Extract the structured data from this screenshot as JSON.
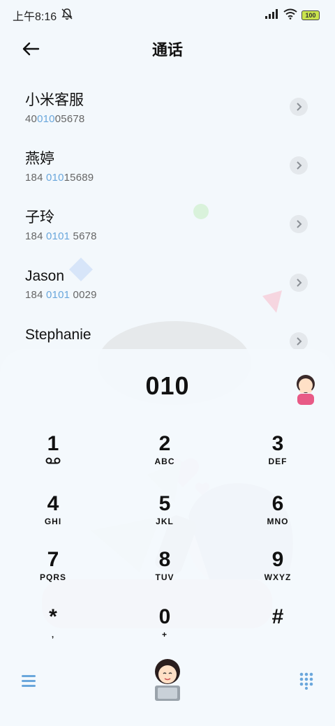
{
  "status_bar": {
    "time": "上午8:16",
    "battery": "100"
  },
  "header": {
    "title": "通话"
  },
  "contacts": [
    {
      "name": "小米客服",
      "number_pre": "40",
      "number_hl": "010",
      "number_post": "05678"
    },
    {
      "name": "燕婷",
      "number_pre": "184 ",
      "number_hl": "010",
      "number_post": "15689"
    },
    {
      "name": "子玲",
      "number_pre": "184 ",
      "number_hl": "0101",
      "number_post": " 5678"
    },
    {
      "name": "Jason",
      "number_pre": "184 ",
      "number_hl": "0101",
      "number_post": " 0029"
    },
    {
      "name": "Stephanie",
      "number_pre": "",
      "number_hl": "",
      "number_post": ""
    }
  ],
  "dialer": {
    "input": "010"
  },
  "keypad": [
    {
      "digit": "1",
      "letters": ""
    },
    {
      "digit": "2",
      "letters": "ABC"
    },
    {
      "digit": "3",
      "letters": "DEF"
    },
    {
      "digit": "4",
      "letters": "GHI"
    },
    {
      "digit": "5",
      "letters": "JKL"
    },
    {
      "digit": "6",
      "letters": "MNO"
    },
    {
      "digit": "7",
      "letters": "PQRS"
    },
    {
      "digit": "8",
      "letters": "TUV"
    },
    {
      "digit": "9",
      "letters": "WXYZ"
    },
    {
      "digit": "*",
      "letters": ","
    },
    {
      "digit": "0",
      "letters": "+"
    },
    {
      "digit": "#",
      "letters": ""
    }
  ],
  "icons": {
    "back": "back-arrow-icon",
    "mute": "bell-muted-icon",
    "signal": "signal-icon",
    "wifi": "wifi-icon",
    "battery": "battery-icon",
    "voicemail": "voicemail-icon",
    "menu": "menu-icon",
    "dialpad": "dialpad-icon",
    "chevron": "chevron-right-icon"
  },
  "colors": {
    "highlight": "#6aa7dc",
    "accent": "#6aa7dc"
  }
}
